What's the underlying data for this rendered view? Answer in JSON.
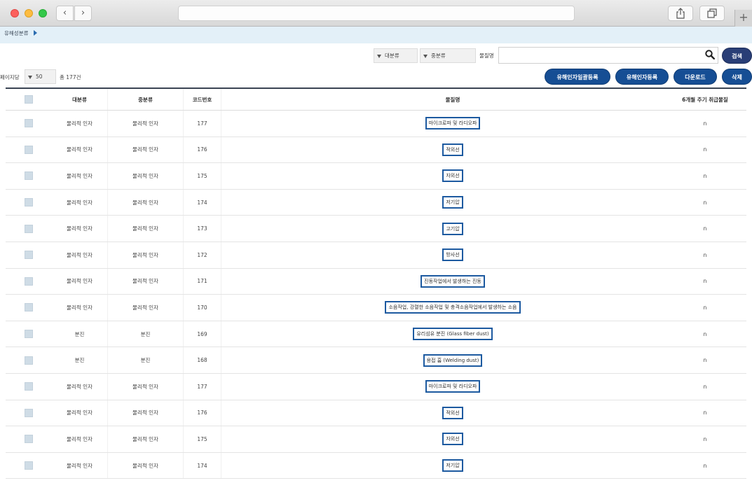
{
  "breadcrumb": {
    "label": "유해성분류"
  },
  "filters": {
    "major_select": "대분류",
    "mid_select": "중분류",
    "search_label": "물질명",
    "search_value": "",
    "search_button": "검색",
    "perpage_label": "페이지당",
    "perpage_value": "50",
    "total": "총 177건"
  },
  "actions": {
    "bulk_register": "유해인자일괄등록",
    "register": "유해인자등록",
    "download": "다운로드",
    "delete": "삭제"
  },
  "table": {
    "headers": {
      "major": "대분류",
      "mid": "중분류",
      "code": "코드번호",
      "name": "물질명",
      "six": "6개월 주기 취급물질"
    },
    "rows": [
      {
        "major": "물리적 인자",
        "mid": "물리적 인자",
        "code": "177",
        "name": "마이크로파 및 라디오파",
        "six": "n"
      },
      {
        "major": "물리적 인자",
        "mid": "물리적 인자",
        "code": "176",
        "name": "적외선",
        "six": "n"
      },
      {
        "major": "물리적 인자",
        "mid": "물리적 인자",
        "code": "175",
        "name": "자외선",
        "six": "n"
      },
      {
        "major": "물리적 인자",
        "mid": "물리적 인자",
        "code": "174",
        "name": "저기압",
        "six": "n"
      },
      {
        "major": "물리적 인자",
        "mid": "물리적 인자",
        "code": "173",
        "name": "고기압",
        "six": "n"
      },
      {
        "major": "물리적 인자",
        "mid": "물리적 인자",
        "code": "172",
        "name": "방사선",
        "six": "n"
      },
      {
        "major": "물리적 인자",
        "mid": "물리적 인자",
        "code": "171",
        "name": "진동작업에서 발생하는 진동",
        "six": "n"
      },
      {
        "major": "물리적 인자",
        "mid": "물리적 인자",
        "code": "170",
        "name": "소음작업, 강렬한 소음작업 및 충격소음작업에서 발생하는 소음",
        "six": "n"
      },
      {
        "major": "분진",
        "mid": "분진",
        "code": "169",
        "name": "유리섬유 분진 (Glass fiber dust)",
        "six": "n"
      },
      {
        "major": "분진",
        "mid": "분진",
        "code": "168",
        "name": "용접 흄 (Welding dust)",
        "six": "n"
      },
      {
        "major": "물리적 인자",
        "mid": "물리적 인자",
        "code": "177",
        "name": "마이크로파 및 라디오파",
        "six": "n"
      },
      {
        "major": "물리적 인자",
        "mid": "물리적 인자",
        "code": "176",
        "name": "적외선",
        "six": "n"
      },
      {
        "major": "물리적 인자",
        "mid": "물리적 인자",
        "code": "175",
        "name": "자외선",
        "six": "n"
      },
      {
        "major": "물리적 인자",
        "mid": "물리적 인자",
        "code": "174",
        "name": "저기압",
        "six": "n"
      }
    ]
  },
  "colors": {
    "primary_button": "#164e94",
    "search_button": "#293e76",
    "breadcrumb_bg": "#e3f0f8",
    "name_border": "#1d5aa0"
  }
}
